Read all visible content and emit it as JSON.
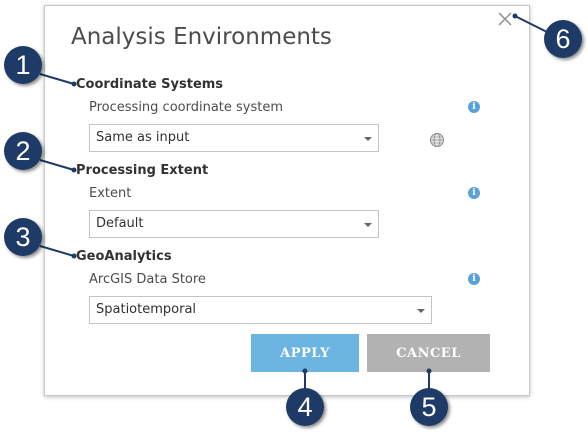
{
  "dialog": {
    "title": "Analysis Environments",
    "close_icon": "close-icon"
  },
  "sections": {
    "coordinate": {
      "title": "Coordinate Systems",
      "label": "Processing coordinate system",
      "value": "Same as input"
    },
    "extent": {
      "title": "Processing Extent",
      "label": "Extent",
      "value": "Default"
    },
    "geoanalytics": {
      "title": "GeoAnalytics",
      "label": "ArcGIS Data Store",
      "value": "Spatiotemporal"
    }
  },
  "info_glyph": "i",
  "buttons": {
    "apply": "APPLY",
    "cancel": "CANCEL"
  },
  "callouts": [
    "1",
    "2",
    "3",
    "4",
    "5",
    "6"
  ],
  "colors": {
    "apply": "#6cb4e2",
    "cancel": "#b2b2b2",
    "callout": "#1e3a66",
    "info": "#5aa1d8"
  }
}
